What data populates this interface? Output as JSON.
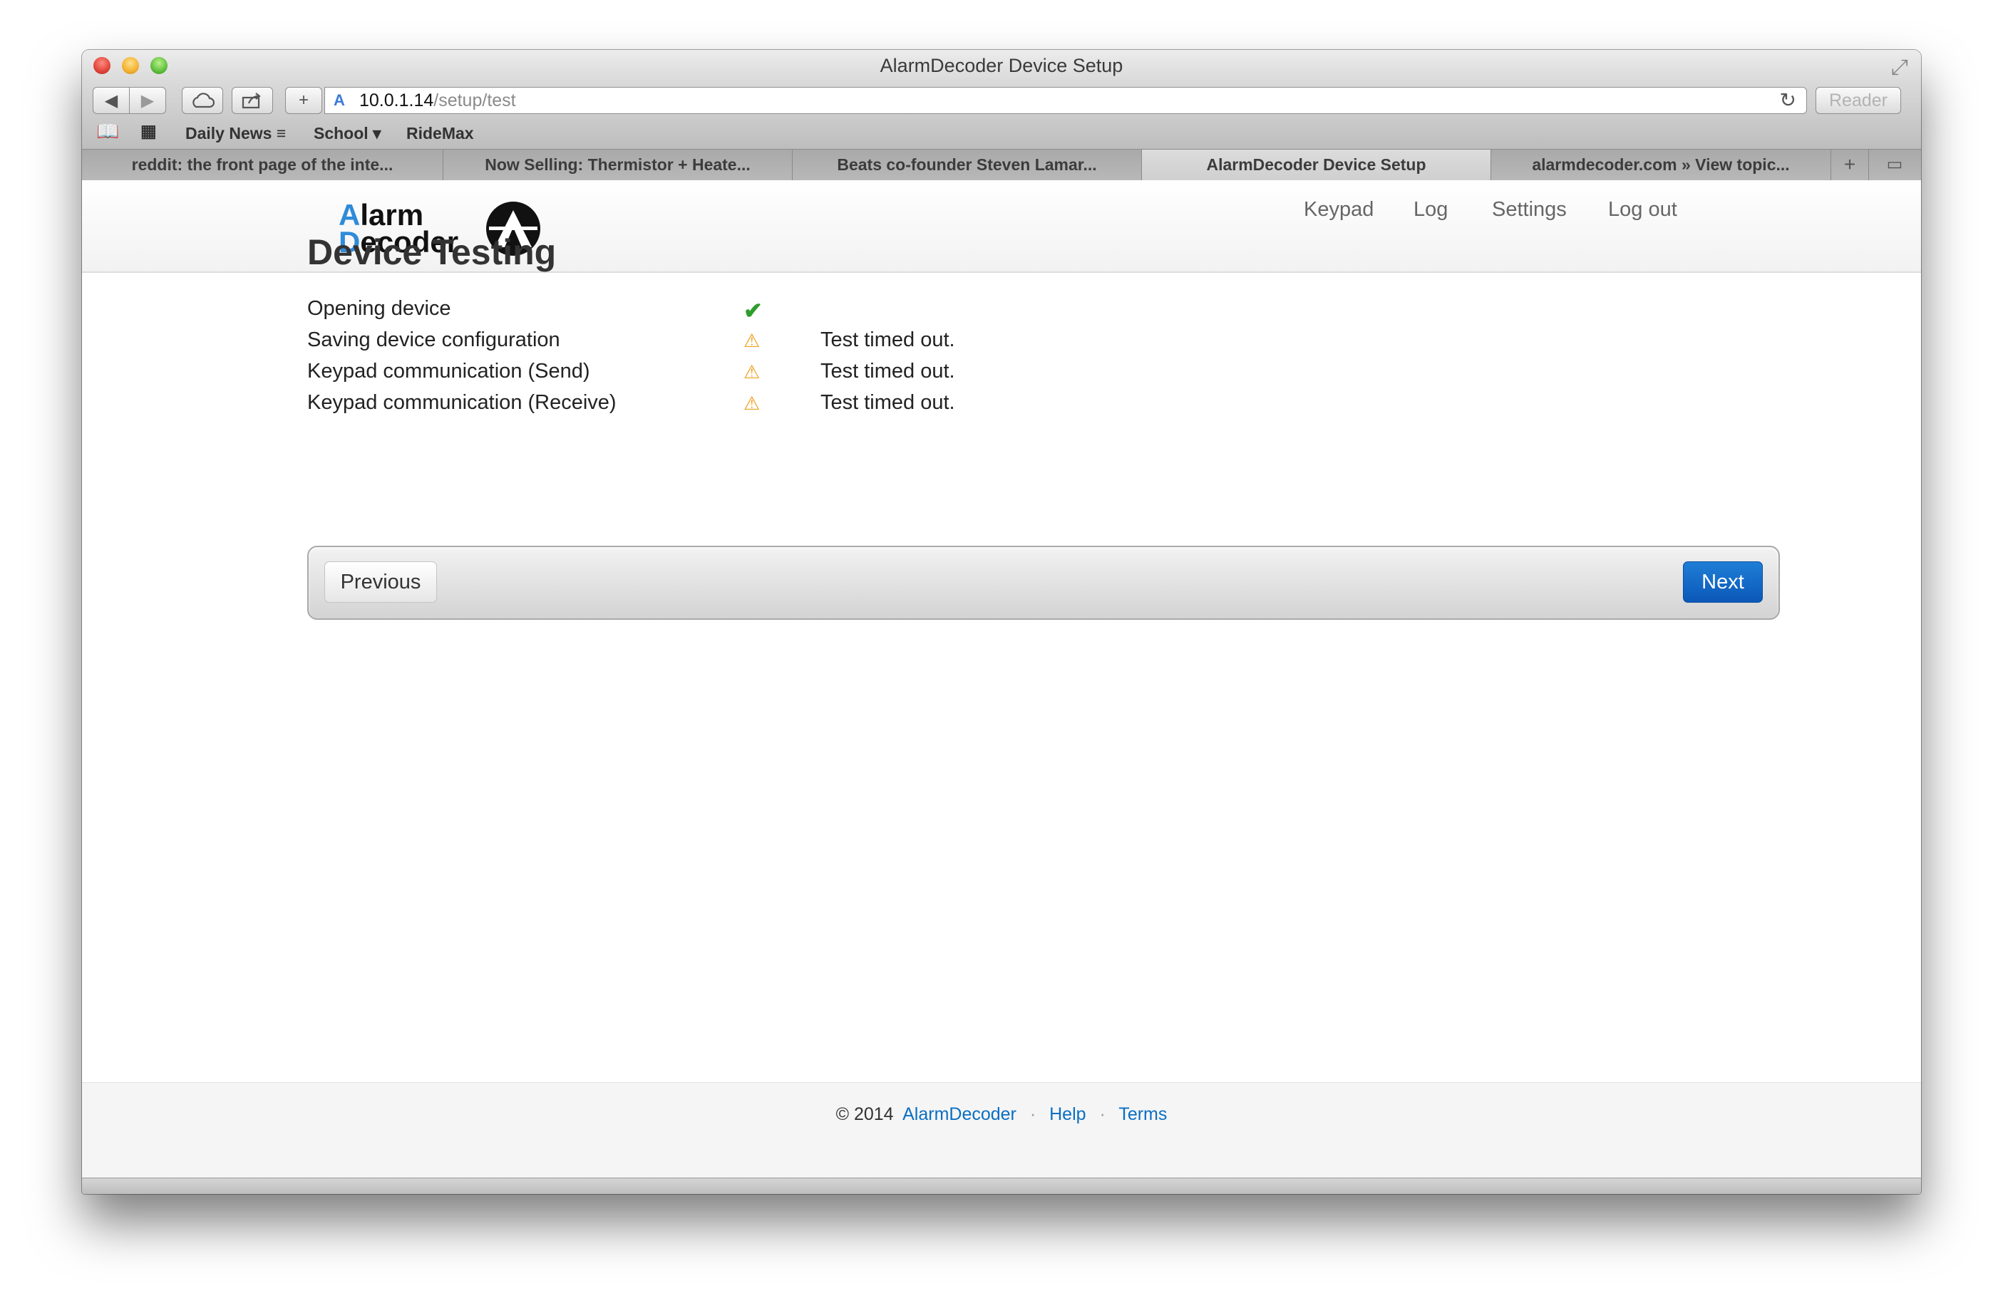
{
  "window": {
    "title": "AlarmDecoder Device Setup"
  },
  "toolbar": {
    "url_host": "10.0.1.14",
    "url_path": "/setup/test",
    "reader_label": "Reader"
  },
  "bookmarks": [
    {
      "label": "Daily News ≡"
    },
    {
      "label": "School ▾"
    },
    {
      "label": "RideMax"
    }
  ],
  "tabs": [
    {
      "label": "reddit: the front page of the inte...",
      "active": false
    },
    {
      "label": "Now Selling: Thermistor + Heate...",
      "active": false
    },
    {
      "label": "Beats co-founder Steven Lamar...",
      "active": false
    },
    {
      "label": "AlarmDecoder Device Setup",
      "active": true
    },
    {
      "label": "alarmdecoder.com » View topic...",
      "active": false
    }
  ],
  "logo": {
    "line1_cap": "A",
    "line1_rest": "larm",
    "line2_cap": "D",
    "line2_rest": "ecoder"
  },
  "nav": {
    "items": [
      "Keypad",
      "Log",
      "Settings",
      "Log out"
    ]
  },
  "main": {
    "title": "Device Testing",
    "tests": [
      {
        "name": "Opening device",
        "status": "ok",
        "message": ""
      },
      {
        "name": "Saving device configuration",
        "status": "warning",
        "message": "Test timed out."
      },
      {
        "name": "Keypad communication (Send)",
        "status": "warning",
        "message": "Test timed out."
      },
      {
        "name": "Keypad communication (Receive)",
        "status": "warning",
        "message": "Test timed out."
      }
    ],
    "previous_label": "Previous",
    "next_label": "Next"
  },
  "footer": {
    "copyright": "© 2014",
    "links": [
      "AlarmDecoder",
      "Help",
      "Terms"
    ],
    "separator": "·"
  },
  "colors": {
    "primary_button": "#0b58b8",
    "link": "#0a6fc2",
    "ok": "#2e9d2e",
    "warning": "#f0a020"
  }
}
